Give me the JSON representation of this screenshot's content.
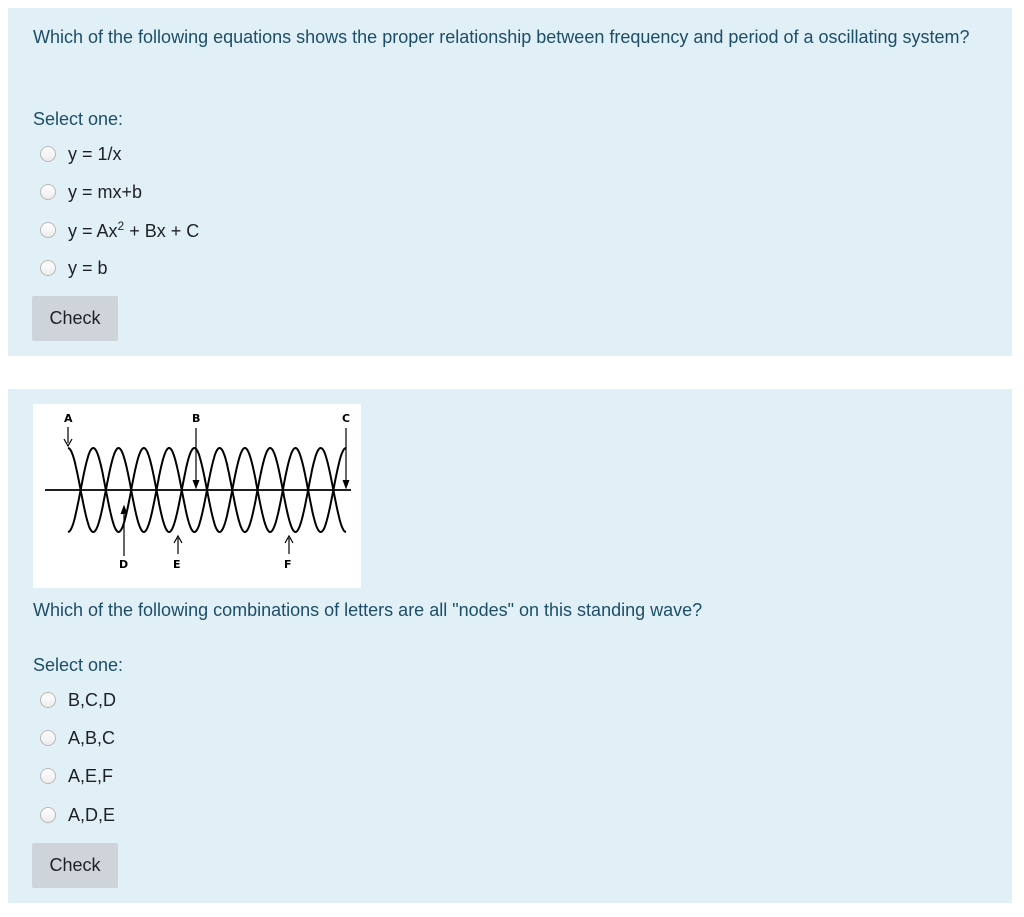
{
  "question1": {
    "text": "Which of the following equations shows the proper relationship between frequency and period of a oscillating system?",
    "select_label": "Select one:",
    "options": [
      {
        "text": "y = 1/x"
      },
      {
        "text": "y = mx+b"
      },
      {
        "pre": "y = Ax",
        "sup": "2",
        "post": " + Bx + C"
      },
      {
        "text": "y = b"
      }
    ],
    "check_label": "Check"
  },
  "question2": {
    "figure_labels": {
      "A": "A",
      "B": "B",
      "C": "C",
      "D": "D",
      "E": "E",
      "F": "F"
    },
    "text": "Which of the following combinations of letters are all \"nodes\" on this standing wave?",
    "select_label": "Select one:",
    "options": [
      {
        "text": "B,C,D"
      },
      {
        "text": "A,B,C"
      },
      {
        "text": "A,E,F"
      },
      {
        "text": "A,D,E"
      }
    ],
    "check_label": "Check"
  }
}
